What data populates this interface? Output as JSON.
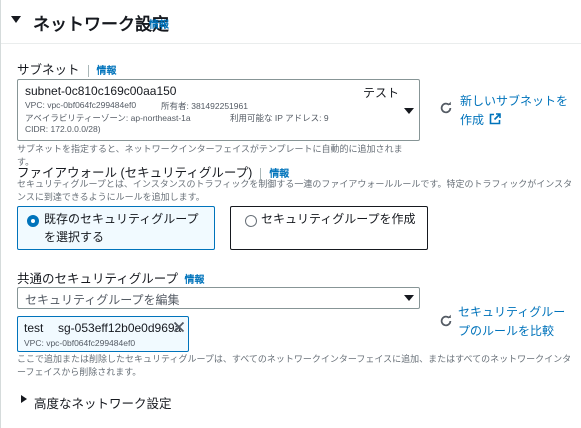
{
  "section": {
    "title": "ネットワーク設定",
    "info": "情報"
  },
  "subnet": {
    "label": "サブネット",
    "info": "情報",
    "selected_id": "subnet-0c810c169c00aa150",
    "selected_name": "テスト",
    "vpc": "VPC: vpc-0bf064fc299484ef0",
    "owner": "所有者: 381492251961",
    "az": "アベイラビリティーゾーン: ap-northeast-1a",
    "ip_available": "利用可能な IP アドレス: 9",
    "cidr": "CIDR: 172.0.0.0/28)",
    "help": "サブネットを指定すると、ネットワークインターフェイスがテンプレートに自動的に追加されます。",
    "new_link": "新しいサブネットを作成"
  },
  "firewall": {
    "label": "ファイアウォール (セキュリティグループ)",
    "info": "情報",
    "desc": "セキュリティグループとは、インスタンスのトラフィックを制御する一連のファイアウォールルールです。特定のトラフィックがインスタンスに到達できるようにルールを追加します。",
    "option_existing": "既存のセキュリティグループを選択する",
    "option_create": "セキュリティグループを作成"
  },
  "common_sg": {
    "label": "共通のセキュリティグループ",
    "info": "情報",
    "placeholder": "セキュリティグループを編集",
    "compare_link": "セキュリティグループのルールを比較",
    "token": {
      "name": "test",
      "id": "sg-053eff12b0e0d969a",
      "vpc": "VPC: vpc-0bf064fc299484ef0"
    },
    "help": "ここで追加または削除したセキュリティグループは、すべてのネットワークインターフェイスに追加、またはすべてのネットワークインターフェイスから削除されます。"
  },
  "advanced": {
    "label": "高度なネットワーク設定"
  },
  "colors": {
    "link": "#0073bb",
    "text": "#16191f",
    "muted": "#687078",
    "selected_bg": "#f1faff"
  }
}
